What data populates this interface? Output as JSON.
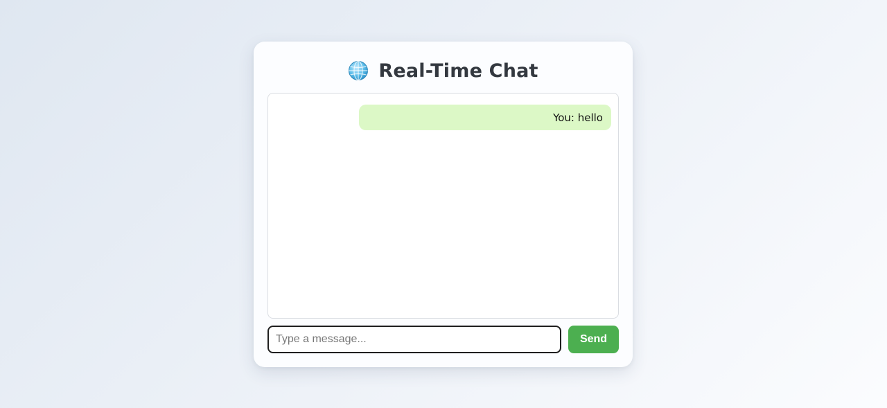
{
  "app": {
    "title": "Real-Time Chat",
    "title_icon": "globe-icon"
  },
  "messages": [
    {
      "text": "You: hello",
      "sender": "self"
    }
  ],
  "composer": {
    "placeholder": "Type a message...",
    "value": "",
    "send_label": "Send"
  },
  "colors": {
    "accent": "#4caf50",
    "own_message_bg": "#dcf8c6",
    "title_text": "#33383f"
  }
}
